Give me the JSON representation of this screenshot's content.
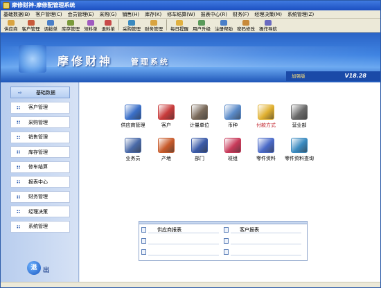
{
  "window": {
    "title": "摩修财神-摩修配管理系统"
  },
  "menu": [
    "基础数据(B)",
    "客户管理(C)",
    "会员管理(E)",
    "采购(G)",
    "销售(H)",
    "库存(K)",
    "修车结算(W)",
    "报表中心(R)",
    "财务(F)",
    "经理决策(M)",
    "系统管理(Z)"
  ],
  "toolbar": [
    {
      "label": "供应商",
      "icon": "supplier-icon",
      "color": "#d9a441"
    },
    {
      "label": "客户管理",
      "icon": "customer-icon",
      "color": "#c85a3a"
    },
    {
      "label": "调拨单",
      "icon": "transfer-icon",
      "color": "#4a7fc8"
    },
    {
      "label": "库存管理",
      "icon": "inventory-icon",
      "color": "#7a9a3a"
    },
    {
      "label": "领料单",
      "icon": "pick-icon",
      "color": "#a05ac0"
    },
    {
      "label": "退料单",
      "icon": "return-icon",
      "color": "#c84a4a"
    },
    {
      "label": "采购管理",
      "icon": "purchase-icon",
      "color": "#3a8ac0"
    },
    {
      "label": "财务管理",
      "icon": "finance-icon",
      "color": "#d9a441"
    },
    {
      "label": "每日提醒",
      "icon": "reminder-icon",
      "color": "#e0b040"
    },
    {
      "label": "用户升级",
      "icon": "upgrade-icon",
      "color": "#5a9a5a"
    },
    {
      "label": "注册帮助",
      "icon": "help-icon",
      "color": "#4a7fc8"
    },
    {
      "label": "密码修改",
      "icon": "password-icon",
      "color": "#c88a3a"
    },
    {
      "label": "操作导航",
      "icon": "navigation-icon",
      "color": "#6a6ac0"
    }
  ],
  "banner": {
    "title": "摩修财神",
    "subtitle": "管理系统",
    "edition": "加强版",
    "version": "V18.28"
  },
  "sidebar": [
    {
      "label": "基础数据",
      "active": true
    },
    {
      "label": "客户管理"
    },
    {
      "label": "采购管理"
    },
    {
      "label": "销售管理"
    },
    {
      "label": "库存管理"
    },
    {
      "label": "修车结算"
    },
    {
      "label": "报表中心"
    },
    {
      "label": "财务管理"
    },
    {
      "label": "经理决策"
    },
    {
      "label": "系统管理"
    }
  ],
  "exit": {
    "icon_char": "退",
    "label": "出"
  },
  "grid": [
    {
      "label": "供应商管理",
      "icon": "supplier-book-icon",
      "color": "#3a6fc8"
    },
    {
      "label": "客户",
      "icon": "customer-books-icon",
      "color": "#c83a3a"
    },
    {
      "label": "计量单位",
      "icon": "unit-building-icon",
      "color": "#7a6a5a"
    },
    {
      "label": "币种",
      "icon": "currency-icon",
      "color": "#5a8ac8"
    },
    {
      "label": "付款方式",
      "icon": "payment-folder-icon",
      "color": "#e0b030",
      "highlight": true
    },
    {
      "label": "营业部",
      "icon": "branch-printer-icon",
      "color": "#6a6a6a"
    },
    {
      "label": "业务员",
      "icon": "salesman-printer-icon",
      "color": "#4a6aa8"
    },
    {
      "label": "产地",
      "icon": "origin-house-icon",
      "color": "#c85a2a"
    },
    {
      "label": "部门",
      "icon": "department-book-icon",
      "color": "#3a5aa8"
    },
    {
      "label": "班组",
      "icon": "team-monitor-icon",
      "color": "#c83a5a"
    },
    {
      "label": "零件资料",
      "icon": "parts-docs-icon",
      "color": "#4a6ac8"
    },
    {
      "label": "零件资料查询",
      "icon": "parts-query-icon",
      "color": "#3a8ac0"
    }
  ],
  "reports": [
    {
      "label": "供应商报表"
    },
    {
      "label": "客户报表"
    },
    {
      "label": ""
    },
    {
      "label": ""
    },
    {
      "label": ""
    },
    {
      "label": ""
    }
  ]
}
